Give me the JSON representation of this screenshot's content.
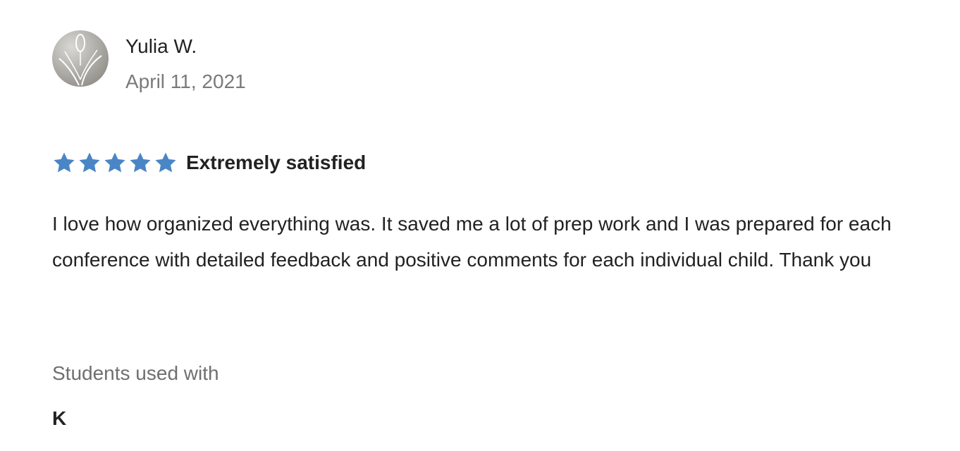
{
  "reviewer": {
    "name": "Yulia W.",
    "date": "April 11, 2021",
    "avatar_icon": "default-avatar-icon"
  },
  "rating": {
    "stars": 5,
    "max_stars": 5,
    "label": "Extremely satisfied",
    "star_color": "#4a86c5",
    "star_icon": "star-icon"
  },
  "review": {
    "text": "I love how organized everything was. It saved me a lot of prep work and I was prepared for each conference with detailed feedback and positive comments for each individual child. Thank you"
  },
  "students": {
    "label": "Students used with",
    "value": "K"
  }
}
